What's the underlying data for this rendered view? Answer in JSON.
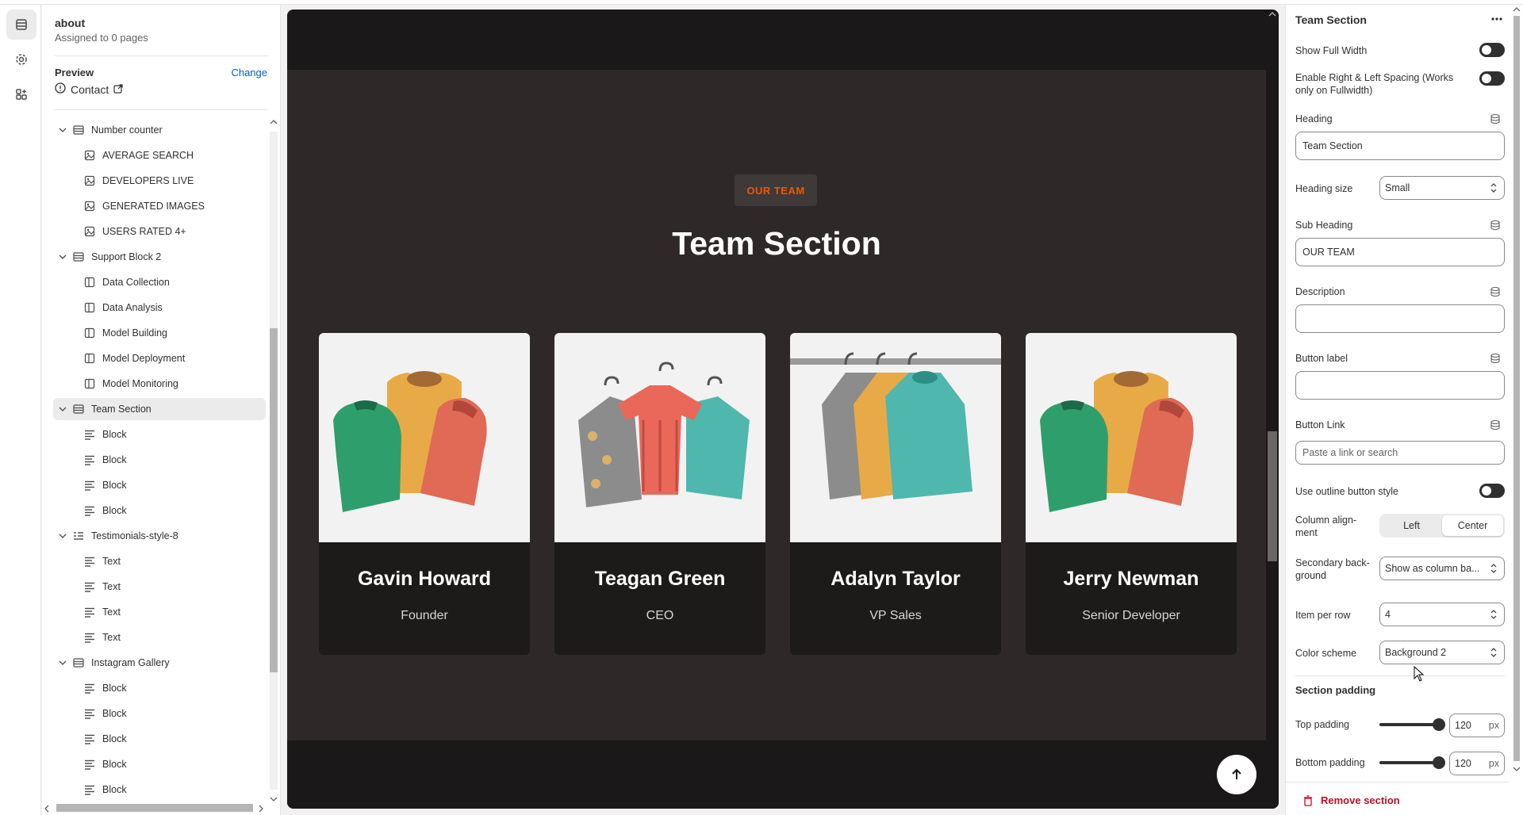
{
  "rail": {
    "items": [
      "sections-icon",
      "settings-icon",
      "apps-icon"
    ]
  },
  "template": {
    "name": "about",
    "assigned": "Assigned to 0 pages",
    "preview_label": "Preview",
    "change_label": "Change",
    "preview_page": "Contact"
  },
  "tree": [
    {
      "label": "Number counter",
      "level": 0,
      "icon": "section"
    },
    {
      "label": "AVERAGE SEARCH",
      "level": 1,
      "icon": "image-block"
    },
    {
      "label": "DEVELOPERS LIVE",
      "level": 1,
      "icon": "image-block"
    },
    {
      "label": "GENERATED IMAGES",
      "level": 1,
      "icon": "image-block"
    },
    {
      "label": "USERS RATED 4+",
      "level": 1,
      "icon": "image-block"
    },
    {
      "label": "Support Block 2",
      "level": 0,
      "icon": "section"
    },
    {
      "label": "Data Collection",
      "level": 1,
      "icon": "column-block"
    },
    {
      "label": "Data Analysis",
      "level": 1,
      "icon": "column-block"
    },
    {
      "label": "Model Building",
      "level": 1,
      "icon": "column-block"
    },
    {
      "label": "Model Deployment",
      "level": 1,
      "icon": "column-block"
    },
    {
      "label": "Model Monitoring",
      "level": 1,
      "icon": "column-block"
    },
    {
      "label": "Team Section",
      "level": 0,
      "icon": "section",
      "active": true
    },
    {
      "label": "Block",
      "level": 1,
      "icon": "text-block"
    },
    {
      "label": "Block",
      "level": 1,
      "icon": "text-block"
    },
    {
      "label": "Block",
      "level": 1,
      "icon": "text-block"
    },
    {
      "label": "Block",
      "level": 1,
      "icon": "text-block"
    },
    {
      "label": "Testimonials-style-8",
      "level": 0,
      "icon": "list-section"
    },
    {
      "label": "Text",
      "level": 1,
      "icon": "text-block"
    },
    {
      "label": "Text",
      "level": 1,
      "icon": "text-block"
    },
    {
      "label": "Text",
      "level": 1,
      "icon": "text-block"
    },
    {
      "label": "Text",
      "level": 1,
      "icon": "text-block"
    },
    {
      "label": "Instagram Gallery",
      "level": 0,
      "icon": "section"
    },
    {
      "label": "Block",
      "level": 1,
      "icon": "text-block"
    },
    {
      "label": "Block",
      "level": 1,
      "icon": "text-block"
    },
    {
      "label": "Block",
      "level": 1,
      "icon": "text-block"
    },
    {
      "label": "Block",
      "level": 1,
      "icon": "text-block"
    },
    {
      "label": "Block",
      "level": 1,
      "icon": "text-block"
    }
  ],
  "preview": {
    "badge": "OUR TEAM",
    "title": "Team Section",
    "members": [
      {
        "name": "Gavin Howard",
        "role": "Founder",
        "image": "folded-shirts"
      },
      {
        "name": "Teagan Green",
        "role": "CEO",
        "image": "hanging-shirts"
      },
      {
        "name": "Adalyn Taylor",
        "role": "VP Sales",
        "image": "rack-sweaters"
      },
      {
        "name": "Jerry Newman",
        "role": "Senior Developer",
        "image": "folded-shirts"
      }
    ],
    "colors": {
      "accent": "#e8590c",
      "section_bg": "#2e2928",
      "card_bg": "#1d1a1a"
    }
  },
  "settings": {
    "title": "Team Section",
    "show_full_width": "Show Full Width",
    "enable_spacing": "Enable Right & Left Spacing (Works only on Fullwidth)",
    "heading_label": "Heading",
    "heading_value": "Team Section",
    "heading_size_label": "Heading size",
    "heading_size_value": "Small",
    "sub_heading_label": "Sub Heading",
    "sub_heading_value": "OUR TEAM",
    "description_label": "Description",
    "button_label_label": "Button label",
    "button_link_label": "Button Link",
    "button_link_placeholder": "Paste a link or search",
    "outline_label": "Use outline button style",
    "column_alignment_label": "Column align-ment",
    "align_left": "Left",
    "align_center": "Center",
    "secondary_bg_label": "Secondary back-ground",
    "secondary_bg_value": "Show as column ba...",
    "item_per_row_label": "Item per row",
    "item_per_row_value": "4",
    "color_scheme_label": "Color scheme",
    "color_scheme_value": "Background 2",
    "section_padding": "Section padding",
    "top_padding_label": "Top padding",
    "top_padding_value": "120",
    "bottom_padding_label": "Bottom padding",
    "bottom_padding_value": "120",
    "unit": "px",
    "remove": "Remove section"
  }
}
